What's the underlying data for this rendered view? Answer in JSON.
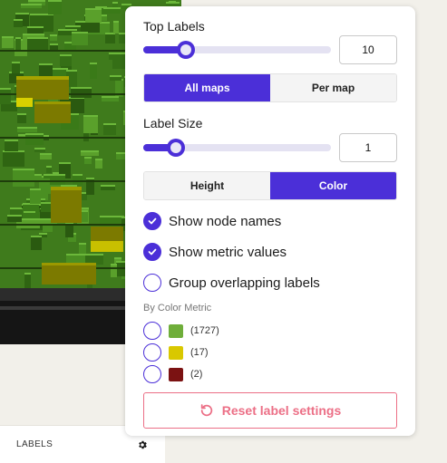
{
  "map": {
    "grass_color": "#3e7d1e",
    "highlight_color": "#d8d000",
    "olive_color": "#7c7a00"
  },
  "panel": {
    "top_labels": {
      "label": "Top Labels",
      "value": "10",
      "slider_fraction": 0.2
    },
    "label_scope": {
      "options": [
        "All maps",
        "Per map"
      ],
      "selected": "All maps"
    },
    "label_size": {
      "label": "Label Size",
      "value": "1",
      "slider_fraction": 0.14
    },
    "label_mode": {
      "options": [
        "Height",
        "Color"
      ],
      "selected": "Color"
    },
    "toggles": [
      {
        "label": "Show node names",
        "checked": true
      },
      {
        "label": "Show metric values",
        "checked": true
      },
      {
        "label": "Group overlapping labels",
        "checked": false
      }
    ],
    "color_metric": {
      "label": "By Color Metric",
      "items": [
        {
          "count": "(1727)",
          "color": "#6fae3a",
          "checked": false
        },
        {
          "count": "(17)",
          "color": "#d9c800",
          "checked": false
        },
        {
          "count": "(2)",
          "color": "#7b1212",
          "checked": false
        }
      ]
    },
    "reset_label": "Reset label settings",
    "accent": "#4b2fd8",
    "danger": "#ec6f86"
  },
  "bottom_bar": {
    "label": "LABELS",
    "icon": "gear-icon"
  }
}
